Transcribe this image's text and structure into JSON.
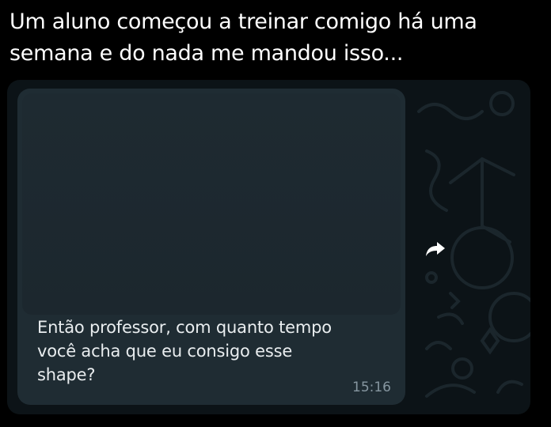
{
  "tweet": {
    "line1": "Um aluno começou a treinar comigo há uma",
    "line2": "semana e do nada me mandou isso..."
  },
  "message": {
    "caption_line1": "Então professor, com quanto tempo",
    "caption_line2": "você acha que eu consigo esse",
    "caption_line3": "shape?",
    "time": "15:16"
  },
  "icons": {
    "forward": "forward-arrow-icon"
  },
  "colors": {
    "background": "#000000",
    "chat_background": "#0c1317",
    "bubble": "#1f2c33",
    "caption_text": "#e9edef",
    "time_text": "#8696a0"
  }
}
